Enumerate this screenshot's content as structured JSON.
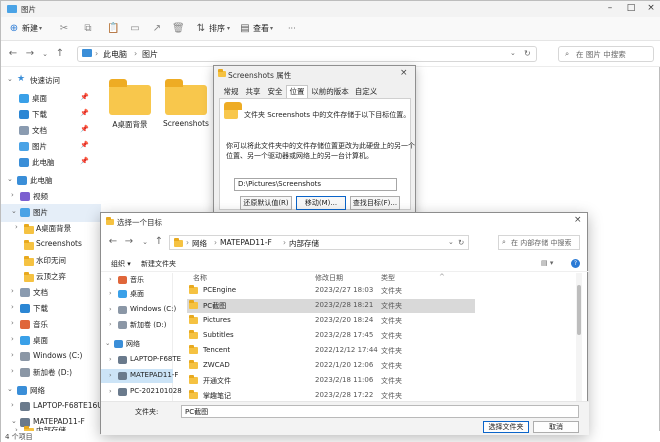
{
  "window": {
    "title": "图片"
  },
  "toolbar": {
    "new": "新建",
    "sort": "排序",
    "view": "查看",
    "more": "···"
  },
  "nav": {
    "breadcrumb": [
      "此电脑",
      "图片"
    ],
    "search_placeholder": "在 图片 中搜索"
  },
  "sidebar": {
    "items": [
      {
        "label": "快速访问"
      },
      {
        "label": "桌面"
      },
      {
        "label": "下载"
      },
      {
        "label": "文档"
      },
      {
        "label": "图片"
      },
      {
        "label": "此电脑"
      },
      {
        "label": "此电脑"
      },
      {
        "label": "视频"
      },
      {
        "label": "图片"
      },
      {
        "label": "A桌面背景"
      },
      {
        "label": "Screenshots"
      },
      {
        "label": "水印无间"
      },
      {
        "label": "云顶之弈"
      },
      {
        "label": "文档"
      },
      {
        "label": "下载"
      },
      {
        "label": "音乐"
      },
      {
        "label": "桌面"
      },
      {
        "label": "Windows (C:)"
      },
      {
        "label": "新加卷 (D:)"
      },
      {
        "label": "网络"
      },
      {
        "label": "LAPTOP-F68TE16U"
      },
      {
        "label": "MATEPAD11-F"
      },
      {
        "label": "内部存储"
      }
    ]
  },
  "content": {
    "folders": [
      "A桌面背景",
      "Screenshots"
    ]
  },
  "status": {
    "count": "4 个项目"
  },
  "props": {
    "title": "Screenshots 属性",
    "tabs": [
      "常规",
      "共享",
      "安全",
      "位置",
      "以前的版本",
      "自定义"
    ],
    "line1": "文件夹 Screenshots 中的文件存储于以下目标位置。",
    "line2": "你可以将此文件夹中的文件存储位置更改为此硬盘上的另一个",
    "line3": "位置、另一个驱动器或网络上的另一台计算机。",
    "path": "D:\\Pictures\\Screenshots",
    "restore": "还原默认值(R)",
    "move": "移动(M)...",
    "find": "查找目标(F)..."
  },
  "browse": {
    "title": "选择一个目标",
    "breadcrumb": [
      "网络",
      "MATEPAD11-F",
      "内部存储"
    ],
    "search_placeholder": "在 内部存储 中搜索",
    "organize": "组织 ▾",
    "new_folder": "新建文件夹",
    "columns": {
      "name": "名称",
      "date": "修改日期",
      "type": "类型"
    },
    "side": [
      {
        "label": "音乐"
      },
      {
        "label": "桌面"
      },
      {
        "label": "Windows (C:)"
      },
      {
        "label": "新加卷 (D:)"
      },
      {
        "label": "网络"
      },
      {
        "label": "LAPTOP-F68TE"
      },
      {
        "label": "MATEPAD11-F"
      },
      {
        "label": "PC-202101028"
      }
    ],
    "files": [
      {
        "name": "PCEngine",
        "date": "2023/2/27 18:03",
        "type": "文件夹"
      },
      {
        "name": "PC截图",
        "date": "2023/2/28 18:21",
        "type": "文件夹"
      },
      {
        "name": "Pictures",
        "date": "2023/2/20 18:24",
        "type": "文件夹"
      },
      {
        "name": "Subtitles",
        "date": "2023/2/28 17:45",
        "type": "文件夹"
      },
      {
        "name": "Tencent",
        "date": "2022/12/12 17:44",
        "type": "文件夹"
      },
      {
        "name": "ZWCAD",
        "date": "2022/1/20 12:06",
        "type": "文件夹"
      },
      {
        "name": "开通文件",
        "date": "2023/2/18 11:06",
        "type": "文件夹"
      },
      {
        "name": "掌趣笔记",
        "date": "2023/2/28 17:22",
        "type": "文件夹"
      }
    ],
    "filename_label": "文件夹:",
    "filename": "PC截图",
    "select": "选择文件夹",
    "cancel": "取消"
  }
}
